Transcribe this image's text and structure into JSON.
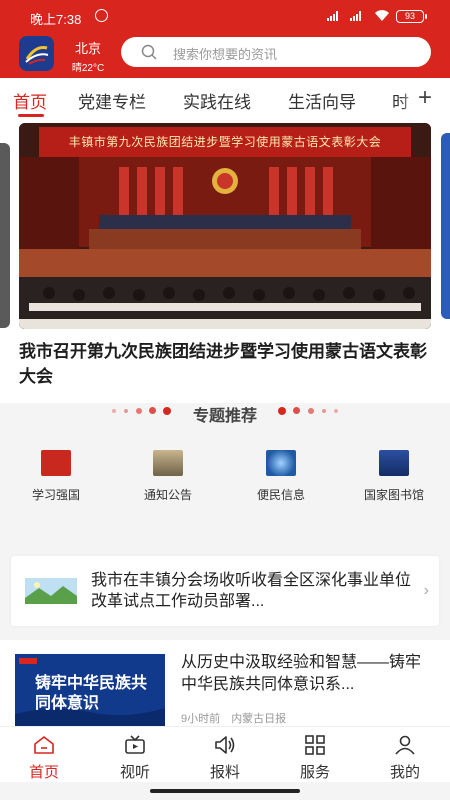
{
  "status_bar": {
    "time": "晚上7:38",
    "battery": "93"
  },
  "header": {
    "city": "北京",
    "weather": "晴22°C",
    "search_placeholder": "搜索你想要的资讯",
    "accent_color": "#d8261f"
  },
  "tabs": [
    {
      "label": "首页",
      "active": true
    },
    {
      "label": "党建专栏",
      "active": false
    },
    {
      "label": "实践在线",
      "active": false
    },
    {
      "label": "生活向导",
      "active": false
    },
    {
      "label": "时",
      "active": false
    }
  ],
  "tabs_add_icon": "plus-icon",
  "banner": {
    "image_sign_text": "丰镇市第九次民族团结进步暨学习使用蒙古语文表彰大会",
    "title": "我市召开第九次民族团结进步暨学习使用蒙古语文表彰大会"
  },
  "section": {
    "title": "专题推荐"
  },
  "shortcuts": [
    {
      "label": "学习强国",
      "icon": "xuexi-qiangguo-icon",
      "color": "#c8281e"
    },
    {
      "label": "通知公告",
      "icon": "buildings-icon",
      "color": "#8a7a5c"
    },
    {
      "label": "便民信息",
      "icon": "globe-icon",
      "color": "#2e6fb5"
    },
    {
      "label": "国家图书馆",
      "icon": "library-icon",
      "color": "#1d3d86"
    }
  ],
  "notice": {
    "text": "我市在丰镇分会场收听收看全区深化事业单位改革试点工作动员部署..."
  },
  "news": [
    {
      "thumb_caption": "铸牢中华民族共同体意识",
      "title": "从历史中汲取经验和智慧——铸牢中华民族共同体意识系...",
      "time": "9小时前",
      "source": "内蒙古日报"
    }
  ],
  "bottom_nav": [
    {
      "label": "首页",
      "icon": "home-icon",
      "active": true
    },
    {
      "label": "视听",
      "icon": "tv-icon",
      "active": false
    },
    {
      "label": "报料",
      "icon": "speaker-icon",
      "active": false
    },
    {
      "label": "服务",
      "icon": "grid-icon",
      "active": false
    },
    {
      "label": "我的",
      "icon": "person-icon",
      "active": false
    }
  ]
}
